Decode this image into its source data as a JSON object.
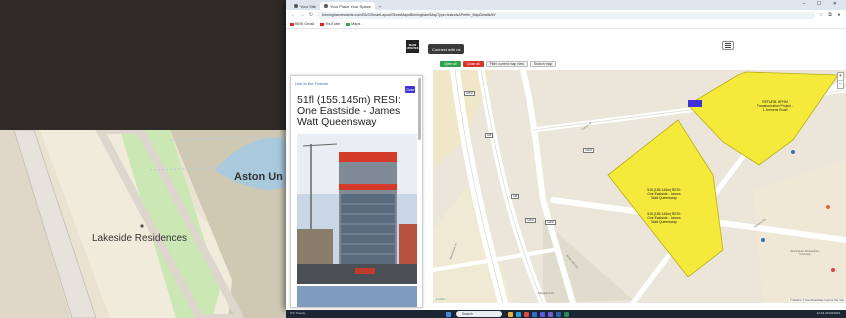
{
  "background_map": {
    "labels": {
      "lakeside": "Lakeside Residences",
      "aston": "Aston Un"
    }
  },
  "browser": {
    "tabs": [
      {
        "label": "Your Site"
      },
      {
        "label": "Your Place Your Space"
      }
    ],
    "new_tab_symbol": "+",
    "window_controls": "– ☐ ✕",
    "nav": {
      "back": "←",
      "forward": "→",
      "reload": "↻"
    },
    "url": "birminghamrewards.com/BUS/SmartLayout/ShowMapsBirmingham/MapType=Islands&Prefer_MapDetails/#!/",
    "bookmarks": [
      {
        "label": "BMS Gmail",
        "color": "#d93025"
      },
      {
        "label": "YouTube",
        "color": "#e62117"
      },
      {
        "label": "Maps",
        "color": "#34a853"
      }
    ]
  },
  "site": {
    "logo_text": "BHAM UPDATES",
    "connect_label": "Connect with us",
    "toolbar": [
      {
        "label": "Open all",
        "style": "green"
      },
      {
        "label": "Close all",
        "style": "red"
      },
      {
        "label": "Filter current map view",
        "style": "plain"
      },
      {
        "label": "Search map",
        "style": "plain"
      }
    ]
  },
  "popup": {
    "link": "Link to the Feature",
    "close": "Close",
    "title": "51fl (155.145m) RESI: One Eastside - James Watt Queensway"
  },
  "map": {
    "zoom_in": "+",
    "zoom_out": "−",
    "polygon_labels": {
      "a1": "51fl (155.145m) RESI:\nOne Eastside - James\nWatt Queensway",
      "a2": "51fl (155.145m) RESI:\nOne Eastside - James\nWatt Queensway",
      "b": "REFURB: BPHM\nTransformation Project -\n1 Jennens Road"
    },
    "road_labels": {
      "curzon": "Curzon St",
      "masshouse": "Masshouse Ln",
      "jennens": "Jennens Rd",
      "james_watt": "James Watt Qy",
      "eastside": "Eastside Park",
      "bpc": "Birmingham Metropolitan University"
    },
    "route_badges": [
      "A4540",
      "A38",
      "A38",
      "A4400",
      "A4400",
      "A4400"
    ],
    "attribution": "© Mapbox © OpenStreetMap Improve this map",
    "leaflet": "Leaflet",
    "highlight_color": "#f5ea3c"
  },
  "taskbar": {
    "weather": "9°C Cloudy",
    "search": "Search",
    "time": "12:33",
    "date": "01/03/2024"
  }
}
